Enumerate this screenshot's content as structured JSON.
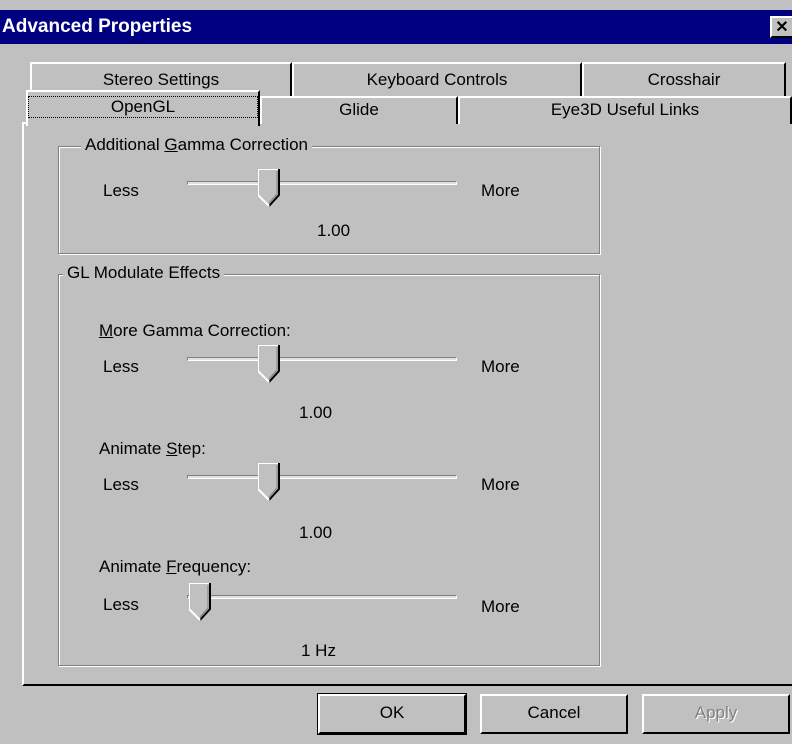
{
  "window": {
    "title": "Advanced Properties",
    "close_label": "✕"
  },
  "tabs": {
    "row_back": [
      "Stereo Settings",
      "Keyboard Controls",
      "Crosshair"
    ],
    "row_front": [
      "OpenGL",
      "Glide",
      "Eye3D Useful Links"
    ],
    "selected": "OpenGL"
  },
  "gamma_group": {
    "legend_pre": "Additional ",
    "legend_ul": "G",
    "legend_post": "amma Correction",
    "less": "Less",
    "more": "More",
    "value": "1.00",
    "slider_fraction": 0.28
  },
  "modulate_group": {
    "legend": "GL Modulate Effects",
    "more_gamma": {
      "label_ul": "M",
      "label_post": "ore Gamma Correction:",
      "less": "Less",
      "more": "More",
      "value": "1.00",
      "slider_fraction": 0.28
    },
    "animate_step": {
      "label_pre": "Animate ",
      "label_ul": "S",
      "label_post": "tep:",
      "less": "Less",
      "more": "More",
      "value": "1.00",
      "slider_fraction": 0.28
    },
    "animate_frequency": {
      "label_pre": "Animate ",
      "label_ul": "F",
      "label_post": "requency:",
      "less": "Less",
      "more": "More",
      "value": "1 Hz",
      "slider_fraction": 0.0
    }
  },
  "buttons": {
    "ok": "OK",
    "cancel": "Cancel",
    "apply": "Apply"
  }
}
